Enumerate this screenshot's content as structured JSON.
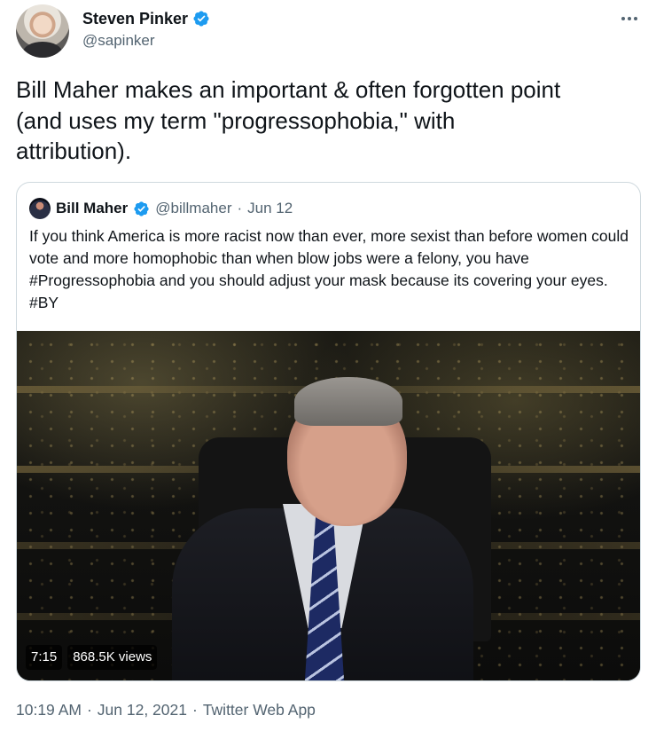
{
  "author": {
    "name": "Steven Pinker",
    "handle": "@sapinker",
    "verified": true
  },
  "tweet": {
    "text": "Bill Maher makes an important & often forgotten point\n(and uses my term \"progressophobia,\" with\nattribution)."
  },
  "quoted": {
    "name": "Bill Maher",
    "handle": "@billmaher",
    "separator": "·",
    "date": "Jun 12",
    "text": "If you think America is more racist now than ever, more sexist than before women could vote and more homophobic than when blow jobs were a felony, you have #Progressophobia and you should adjust your mask because its covering your eyes. #BY",
    "media": {
      "duration": "7:15",
      "views": "868.5K views"
    }
  },
  "meta": {
    "time": "10:19 AM",
    "separator": "·",
    "date": "Jun 12, 2021",
    "separator2": "·",
    "client": "Twitter Web App"
  },
  "icons": {
    "more": "more-dots-icon",
    "verified": "verified-badge-icon"
  },
  "colors": {
    "verified_blue": "#1d9bf0",
    "secondary_text": "#536471",
    "border": "#cfd9de"
  }
}
